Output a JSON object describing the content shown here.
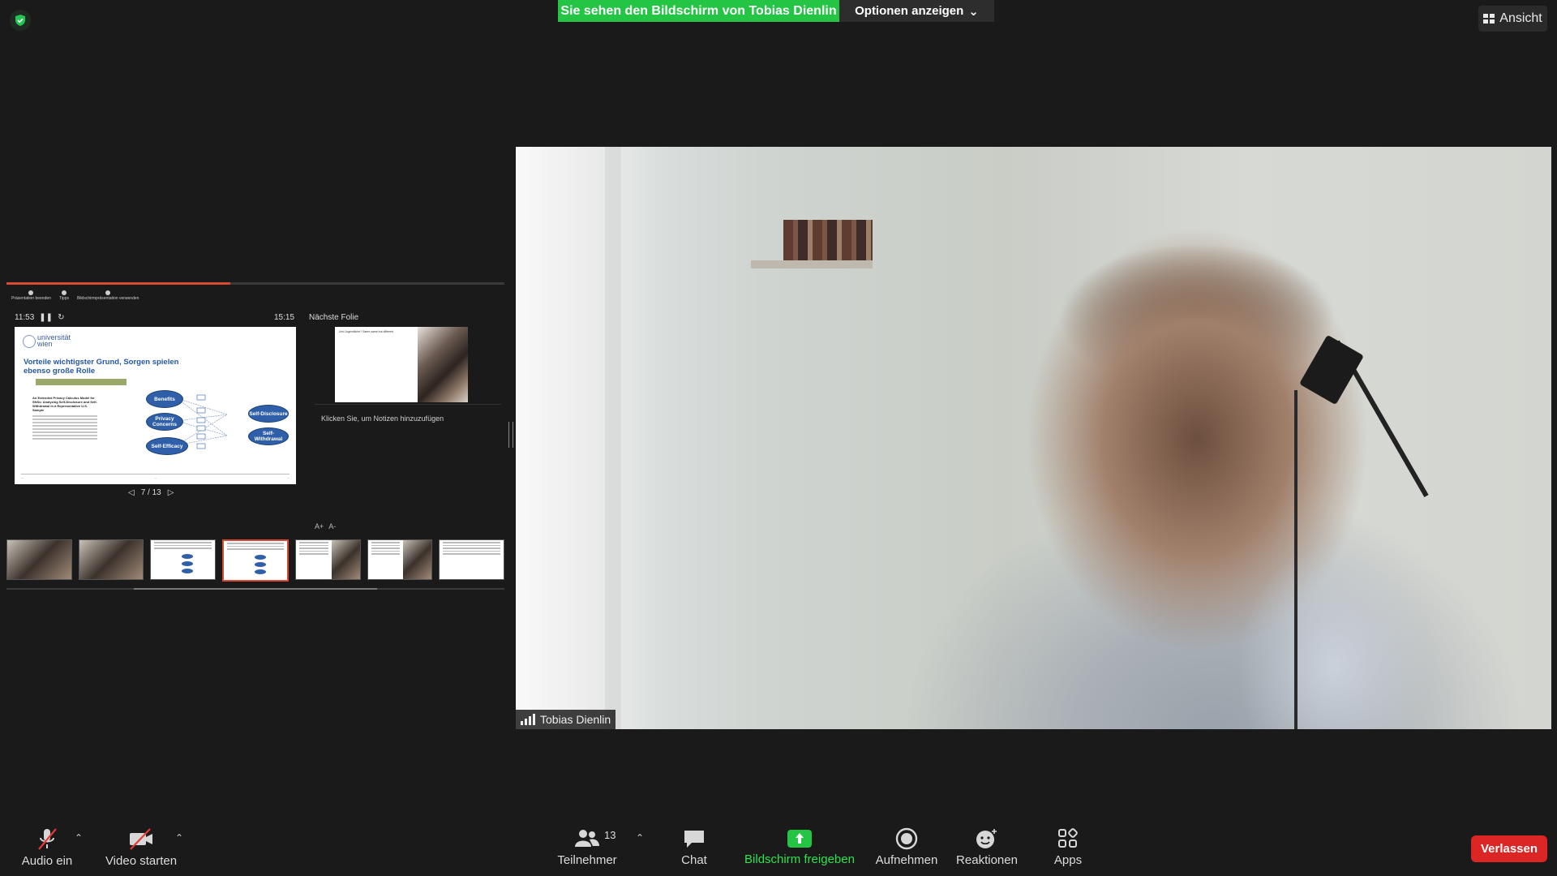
{
  "top": {
    "share_banner": "Sie sehen den Bildschirm von Tobias Dienlin",
    "options_label": "Optionen anzeigen",
    "view_label": "Ansicht"
  },
  "presenter": {
    "progress_fraction": 0.45,
    "toolbar": [
      "Präsentation beenden",
      "Tipps",
      "Bildschirmpräsentation verwenden"
    ],
    "elapsed_time": "11:53",
    "clock_time": "15:15",
    "next_label": "Nächste Folie",
    "slide_counter": "7 / 13",
    "notes_placeholder": "Klicken Sie, um Notizen hinzuzufügen",
    "current_slide": {
      "logo_text": "universität wien",
      "title": "Vorteile wichtigster Grund, Sorgen spielen ebenso große Rolle",
      "paper_title": "An Extended Privacy Calculus Model for SNSs: Analyzing Self-Disclosure and Self-Withdrawal in a Representative U.S. Sample",
      "nodes": {
        "benefits": "Benefits",
        "privacy_concerns": "Privacy Concerns",
        "self_efficacy": "Self-Efficacy",
        "self_disclosure": "Self-Disclosure",
        "self_withdrawal": "Self-Withdrawal"
      }
    },
    "next_slide": {
      "title": "Und Jugendliche? Same same but different",
      "logo_text": "universität wien"
    },
    "font_buttons": [
      "A+",
      "A-"
    ],
    "thumbnails": [
      {
        "number": "4",
        "type": "photo"
      },
      {
        "number": "5",
        "type": "photo"
      },
      {
        "number": "6",
        "type": "diagram"
      },
      {
        "number": "7",
        "type": "diagram",
        "active": true
      },
      {
        "number": "8",
        "type": "textphoto"
      },
      {
        "number": "9",
        "type": "textphoto"
      },
      {
        "number": "10",
        "type": "text"
      }
    ]
  },
  "video": {
    "participant_name": "Tobias Dienlin"
  },
  "toolbar": {
    "audio_label": "Audio ein",
    "video_label": "Video starten",
    "participants_label": "Teilnehmer",
    "participants_count": "13",
    "chat_label": "Chat",
    "share_label": "Bildschirm freigeben",
    "record_label": "Aufnehmen",
    "reactions_label": "Reaktionen",
    "apps_label": "Apps",
    "leave_label": "Verlassen"
  },
  "colors": {
    "share_green": "#24c445",
    "leave_red": "#dc2626",
    "progress_red": "#d84a34",
    "node_blue": "#2f5fa8"
  }
}
